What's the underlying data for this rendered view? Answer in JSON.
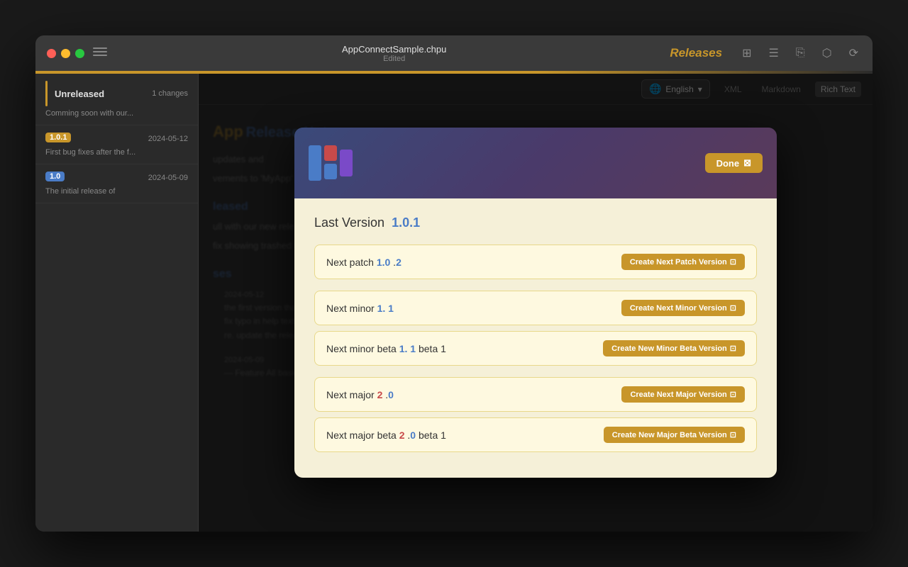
{
  "window": {
    "filename": "AppConnectSample.chpu",
    "status": "Edited"
  },
  "titlebar": {
    "releases_label": "Releases",
    "sidebar_toggle_title": "Toggle Sidebar"
  },
  "sidebar": {
    "items": [
      {
        "id": "unreleased",
        "title": "Unreleased",
        "badge": "1 changes",
        "date": "",
        "desc": "Comming soon with our..."
      },
      {
        "id": "v101",
        "version": "1.0.1",
        "version_color": "orange",
        "date": "2024-05-12",
        "desc": "First bug fixes after the f..."
      },
      {
        "id": "v10",
        "version": "1.0",
        "version_color": "blue",
        "date": "2024-05-09",
        "desc": "The initial release of"
      }
    ]
  },
  "toolbar": {
    "language": "English",
    "format_buttons": [
      "XML",
      "Markdown",
      "Rich Text"
    ],
    "active_format": "Rich Text"
  },
  "panel": {
    "app_name": "App",
    "release_notes": "Release Notes",
    "desc1": "updates and",
    "desc2": "vements to 'MyApp'",
    "released_label": "leased",
    "released_desc1": "ull with our new release",
    "released_desc2": "fix showing trashed translations",
    "releases_label": "ses",
    "release_date1": "2024-05-12",
    "release_desc1": "the first version that released",
    "release_fix1": "fix typo in help texts",
    "release_fix2": "re. update the release rich text file",
    "release_date2": "2024-05-09",
    "release_desc2": "— Feature   All basic features"
  },
  "modal": {
    "last_version_label": "Last Version",
    "last_version_num": "1.0.1",
    "done_button": "Done",
    "version_rows": [
      {
        "label_prefix": "Next patch",
        "label_bold1": "1.0",
        "label_sep": " .",
        "label_bold2": "2",
        "button_label": "Create Next Patch Version",
        "group": 1
      },
      {
        "label_prefix": "Next minor",
        "label_bold1": "1.",
        "label_sep": " ",
        "label_bold2": "1",
        "button_label": "Create Next Minor Version",
        "group": 2
      },
      {
        "label_prefix": "Next minor beta",
        "label_bold1": "1.",
        "label_sep": " ",
        "label_bold2": "1",
        "label_suffix": " beta 1",
        "button_label": "Create New Minor Beta Version",
        "group": 2
      },
      {
        "label_prefix": "Next major",
        "label_bold1": "2",
        "label_sep": " .",
        "label_bold2": "0",
        "button_label": "Create Next Major Version",
        "group": 3
      },
      {
        "label_prefix": "Next major beta",
        "label_bold1": "2",
        "label_sep": " .",
        "label_bold2": "0",
        "label_suffix": " beta 1",
        "button_label": "Create New Major Beta Version",
        "group": 3
      }
    ]
  }
}
